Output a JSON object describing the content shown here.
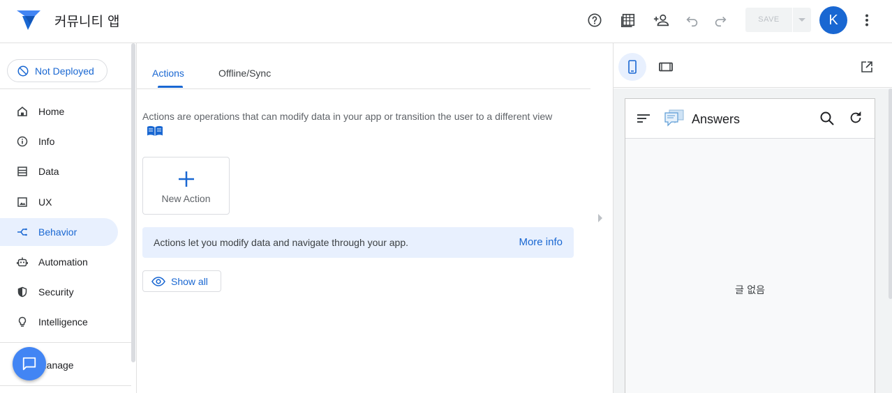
{
  "app": {
    "title": "커뮤니티 앱",
    "save_label": "SAVE",
    "avatar_initial": "K",
    "accent": "#1967d2"
  },
  "toolbar_icons": [
    "help-icon",
    "table-icon",
    "add-person-icon",
    "undo-icon",
    "redo-icon",
    "more-vert-icon"
  ],
  "deploy": {
    "label": "Not Deployed"
  },
  "sidebar": {
    "items": [
      {
        "label": "Home",
        "icon": "home-icon"
      },
      {
        "label": "Info",
        "icon": "info-icon"
      },
      {
        "label": "Data",
        "icon": "data-icon"
      },
      {
        "label": "UX",
        "icon": "image-icon"
      },
      {
        "label": "Behavior",
        "icon": "behavior-icon",
        "active": true
      },
      {
        "label": "Automation",
        "icon": "robot-icon"
      },
      {
        "label": "Security",
        "icon": "shield-icon"
      },
      {
        "label": "Intelligence",
        "icon": "lightbulb-icon"
      },
      {
        "label": "Manage",
        "icon": "manage-icon"
      }
    ]
  },
  "main": {
    "tabs": [
      {
        "label": "Actions",
        "active": true
      },
      {
        "label": "Offline/Sync"
      }
    ],
    "description": "Actions are operations that can modify data in your app or transition the user to a different view",
    "new_action_label": "New Action",
    "info_text": "Actions let you modify data and navigate through your app.",
    "info_link": "More info",
    "show_all_label": "Show all"
  },
  "preview": {
    "app_title": "Answers",
    "empty_text": "글 없음"
  }
}
